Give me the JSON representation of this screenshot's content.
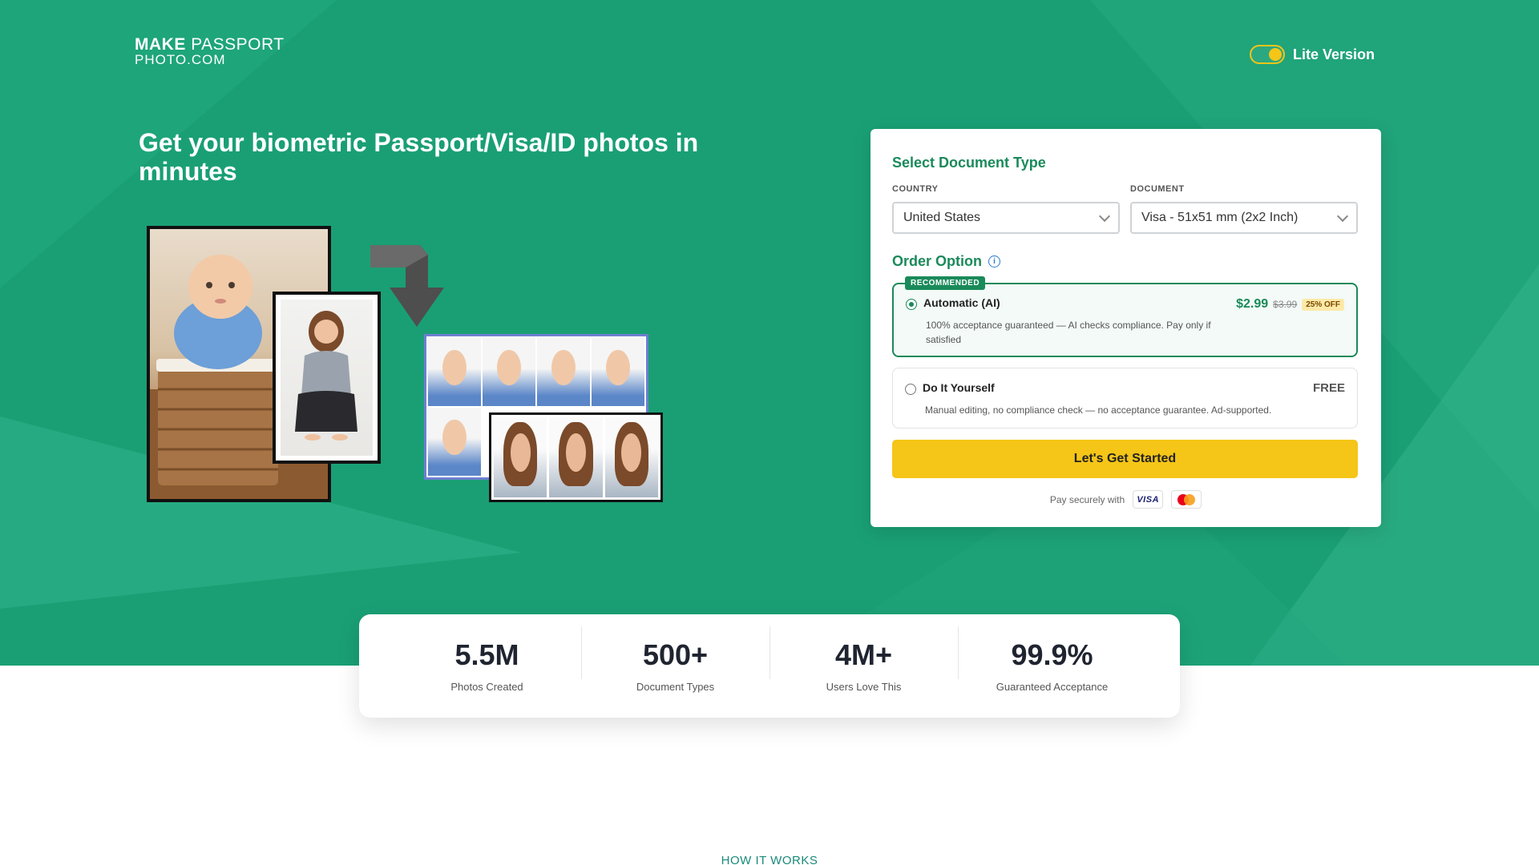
{
  "brand": {
    "line1_bold": "MAKE",
    "line1_light": "PASSPORT",
    "line2": "PHOTO.COM"
  },
  "header": {
    "lite_toggle_label": "Lite Version",
    "lite_toggle_on": true
  },
  "hero": {
    "headline": "Get your biometric Passport/Visa/ID photos in minutes"
  },
  "form": {
    "title": "Select Document Type",
    "country_label": "COUNTRY",
    "country_value": "United States",
    "document_label": "DOCUMENT",
    "document_value": "Visa - 51x51 mm (2x2 Inch)",
    "order_title": "Order Option",
    "info_icon": "i",
    "options": [
      {
        "badge": "RECOMMENDED",
        "name": "Automatic (AI)",
        "description": "100% acceptance guaranteed — AI checks compliance. Pay only if satisfied",
        "price": "$2.99",
        "old_price": "$3.99",
        "discount": "25% OFF",
        "selected": true
      },
      {
        "name": "Do It Yourself",
        "description": "Manual editing, no compliance check — no acceptance guarantee. Ad-supported.",
        "price": "FREE",
        "selected": false
      }
    ],
    "cta_label": "Let's Get Started",
    "pay_label": "Pay securely with",
    "visa_label": "VISA"
  },
  "stats": [
    {
      "value": "5.5M",
      "label": "Photos Created"
    },
    {
      "value": "500+",
      "label": "Document Types"
    },
    {
      "value": "4M+",
      "label": "Users Love This"
    },
    {
      "value": "99.9%",
      "label": "Guaranteed Acceptance"
    }
  ],
  "section": {
    "how_it_works": "HOW IT WORKS"
  },
  "colors": {
    "brand_green": "#1a9f75",
    "accent_green": "#1a8a5a",
    "cta_yellow": "#f5c518"
  }
}
